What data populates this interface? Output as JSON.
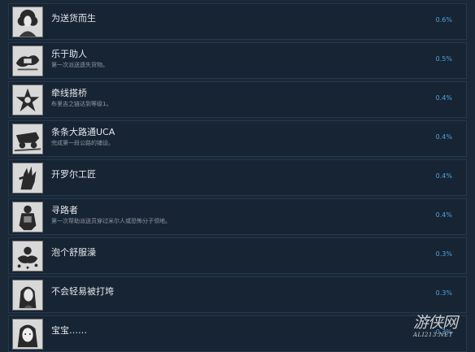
{
  "achievements": [
    {
      "title": "为送货而生",
      "desc": "",
      "percent": "0.6%",
      "icon": "portrait-curly-hair-icon"
    },
    {
      "title": "乐于助人",
      "desc": "第一次派送遗失货物。",
      "percent": "0.5%",
      "icon": "cargo-blob-icon"
    },
    {
      "title": "牵线搭桥",
      "desc": "布里吉之链达到等级1。",
      "percent": "0.4%",
      "icon": "chiral-star-icon"
    },
    {
      "title": "条条大路通UCA",
      "desc": "完成第一段公路的铺设。",
      "percent": "0.4%",
      "icon": "road-vehicle-icon"
    },
    {
      "title": "开罗尔工匠",
      "desc": "",
      "percent": "0.4%",
      "icon": "craftsman-hand-icon"
    },
    {
      "title": "寻路者",
      "desc": "第一次帮助派送员穿过米尔人或恐怖分子领地。",
      "percent": "0.4%",
      "icon": "porter-figure-icon"
    },
    {
      "title": "泡个舒服澡",
      "desc": "",
      "percent": "0.3%",
      "icon": "bath-splash-icon"
    },
    {
      "title": "不会轻易被打垮",
      "desc": "",
      "percent": "0.3%",
      "icon": "portrait-woman-icon"
    },
    {
      "title": "宝宝……",
      "desc": "",
      "percent": "0.3%",
      "icon": "portrait-baby-icon"
    }
  ],
  "watermark": {
    "cn": "游侠网",
    "en": "ALI213.NET"
  }
}
